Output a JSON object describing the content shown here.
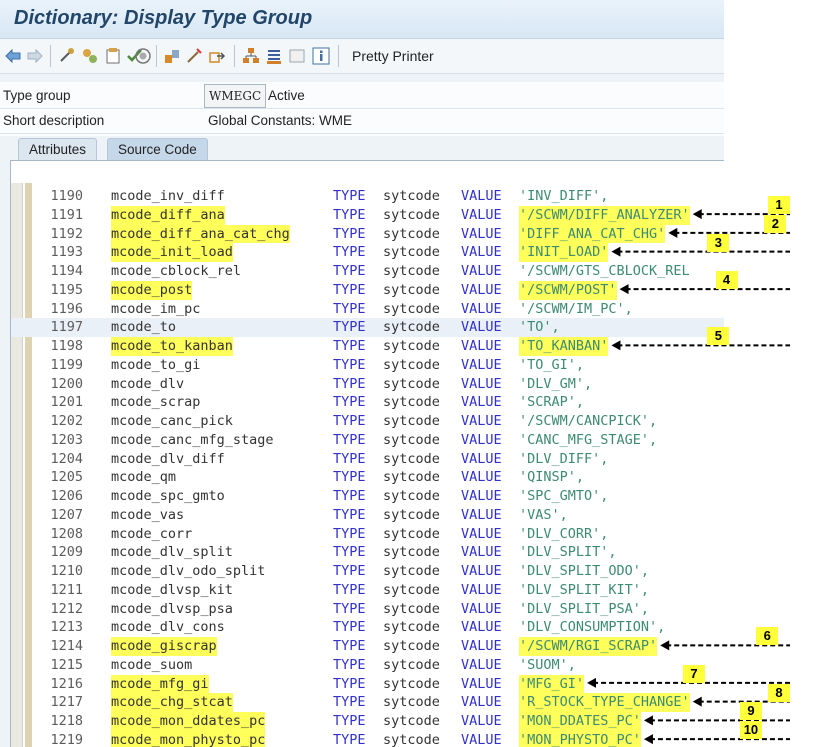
{
  "window": {
    "title": "Dictionary: Display Type Group"
  },
  "toolbar": {
    "icons": [
      "back-arrow-icon",
      "forward-arrow-icon",
      "other-object-icon",
      "display-change-icon",
      "active-inactive-icon",
      "check-icon",
      "activate-icon",
      "where-used-icon",
      "object-list-icon",
      "navigation-icon",
      "hierarchy-icon",
      "documentation-icon",
      "display-object-icon",
      "info-icon"
    ],
    "pretty_printer_label": "Pretty Printer"
  },
  "header": {
    "type_group_label": "Type group",
    "type_group_value": "WMEGC",
    "status": "Active",
    "short_desc_label": "Short description",
    "short_desc_value": "Global Constants: WME"
  },
  "tabs": [
    {
      "label": "Attributes",
      "active": false
    },
    {
      "label": "Source Code",
      "active": true
    }
  ],
  "code": {
    "keyword_type": "TYPE",
    "keyword_value": "VALUE",
    "type_name": "sytcode",
    "lines": [
      {
        "num": "1190",
        "name": "mcode_inv_diff",
        "literal": "'INV_DIFF',",
        "highlight": false
      },
      {
        "num": "1191",
        "name": "mcode_diff_ana",
        "literal": "'/SCWM/DIFF_ANALYZER'",
        "highlight": true
      },
      {
        "num": "1192",
        "name": "mcode_diff_ana_cat_chg",
        "literal": "'DIFF_ANA_CAT_CHG'",
        "highlight": true
      },
      {
        "num": "1193",
        "name": "mcode_init_load",
        "literal": "'INIT_LOAD'",
        "highlight": true
      },
      {
        "num": "1194",
        "name": "mcode_cblock_rel",
        "literal": "'/SCWM/GTS_CBLOCK_REL",
        "highlight": false
      },
      {
        "num": "1195",
        "name": "mcode_post",
        "literal": "'/SCWM/POST'",
        "highlight": true
      },
      {
        "num": "1196",
        "name": "mcode_im_pc",
        "literal": "'/SCWM/IM_PC',",
        "highlight": false
      },
      {
        "num": "1197",
        "name": "mcode_to",
        "literal": "'TO',",
        "highlight": false,
        "selected": true
      },
      {
        "num": "1198",
        "name": "mcode_to_kanban",
        "literal": "'TO_KANBAN'",
        "highlight": true
      },
      {
        "num": "1199",
        "name": "mcode_to_gi",
        "literal": "'TO_GI',",
        "highlight": false
      },
      {
        "num": "1200",
        "name": "mcode_dlv",
        "literal": "'DLV_GM',",
        "highlight": false
      },
      {
        "num": "1201",
        "name": "mcode_scrap",
        "literal": "'SCRAP',",
        "highlight": false
      },
      {
        "num": "1202",
        "name": "mcode_canc_pick",
        "literal": "'/SCWM/CANCPICK',",
        "highlight": false
      },
      {
        "num": "1203",
        "name": "mcode_canc_mfg_stage",
        "literal": "'CANC_MFG_STAGE',",
        "highlight": false
      },
      {
        "num": "1204",
        "name": "mcode_dlv_diff",
        "literal": "'DLV_DIFF',",
        "highlight": false
      },
      {
        "num": "1205",
        "name": "mcode_qm",
        "literal": "'QINSP',",
        "highlight": false
      },
      {
        "num": "1206",
        "name": "mcode_spc_gmto",
        "literal": "'SPC_GMTO',",
        "highlight": false
      },
      {
        "num": "1207",
        "name": "mcode_vas",
        "literal": "'VAS',",
        "highlight": false
      },
      {
        "num": "1208",
        "name": "mcode_corr",
        "literal": "'DLV_CORR',",
        "highlight": false
      },
      {
        "num": "1209",
        "name": "mcode_dlv_split",
        "literal": "'DLV_SPLIT',",
        "highlight": false
      },
      {
        "num": "1210",
        "name": "mcode_dlv_odo_split",
        "literal": "'DLV_SPLIT_ODO',",
        "highlight": false
      },
      {
        "num": "1211",
        "name": "mcode_dlvsp_kit",
        "literal": "'DLV_SPLIT_KIT',",
        "highlight": false
      },
      {
        "num": "1212",
        "name": "mcode_dlvsp_psa",
        "literal": "'DLV_SPLIT_PSA',",
        "highlight": false
      },
      {
        "num": "1213",
        "name": "mcode_dlv_cons",
        "literal": "'DLV_CONSUMPTION',",
        "highlight": false
      },
      {
        "num": "1214",
        "name": "mcode_giscrap",
        "literal": "'/SCWM/RGI_SCRAP'",
        "highlight": true
      },
      {
        "num": "1215",
        "name": "mcode_suom",
        "literal": "'SUOM',",
        "highlight": false
      },
      {
        "num": "1216",
        "name": "mcode_mfg_gi",
        "literal": "'MFG_GI'",
        "highlight": true
      },
      {
        "num": "1217",
        "name": "mcode_chg_stcat",
        "literal": "'R_STOCK_TYPE_CHANGE'",
        "highlight": true
      },
      {
        "num": "1218",
        "name": "mcode_mon_ddates_pc",
        "literal": "'MON_DDATES_PC'",
        "highlight": true
      },
      {
        "num": "1219",
        "name": "mcode_mon_physto_pc",
        "literal": "'MON_PHYSTO_PC'",
        "highlight": true
      }
    ]
  },
  "annotations": [
    {
      "label": "1",
      "line": "1191"
    },
    {
      "label": "2",
      "line": "1192"
    },
    {
      "label": "3",
      "line": "1193"
    },
    {
      "label": "4",
      "line": "1195"
    },
    {
      "label": "5",
      "line": "1198"
    },
    {
      "label": "6",
      "line": "1214"
    },
    {
      "label": "7",
      "line": "1216"
    },
    {
      "label": "8",
      "line": "1217"
    },
    {
      "label": "9",
      "line": "1218"
    },
    {
      "label": "10",
      "line": "1219"
    }
  ]
}
